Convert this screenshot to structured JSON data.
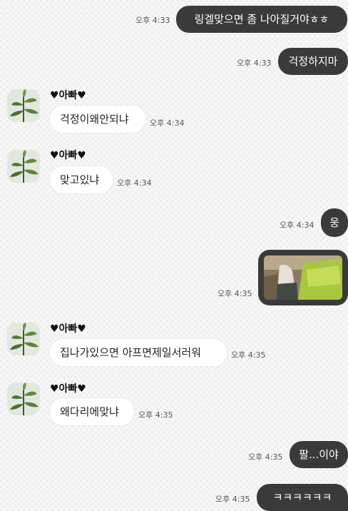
{
  "sender_name": "♥아빠♥",
  "messages": [
    {
      "text": "링겔맞으면 좀 나아질거야ㅎㅎ",
      "time": "오후 4:33"
    },
    {
      "text": "걱정하지마",
      "time": "오후 4:33"
    },
    {
      "text": "걱정이왜안되냐",
      "time": "오후 4:34"
    },
    {
      "text": "맞고있냐",
      "time": "오후 4:34"
    },
    {
      "text": "웅",
      "time": "오후 4:34"
    },
    {
      "text": "",
      "time": "오후 4:35"
    },
    {
      "text": "집나가있으면 아프면제일서러워",
      "time": "오후 4:35"
    },
    {
      "text": "왜다리에맞냐",
      "time": "오후 4:35"
    },
    {
      "text": "팔...이야",
      "time": "오후 4:35"
    },
    {
      "text": "ㅋㅋㅋㅋㅋㅋ",
      "time": "오후 4:35"
    }
  ]
}
